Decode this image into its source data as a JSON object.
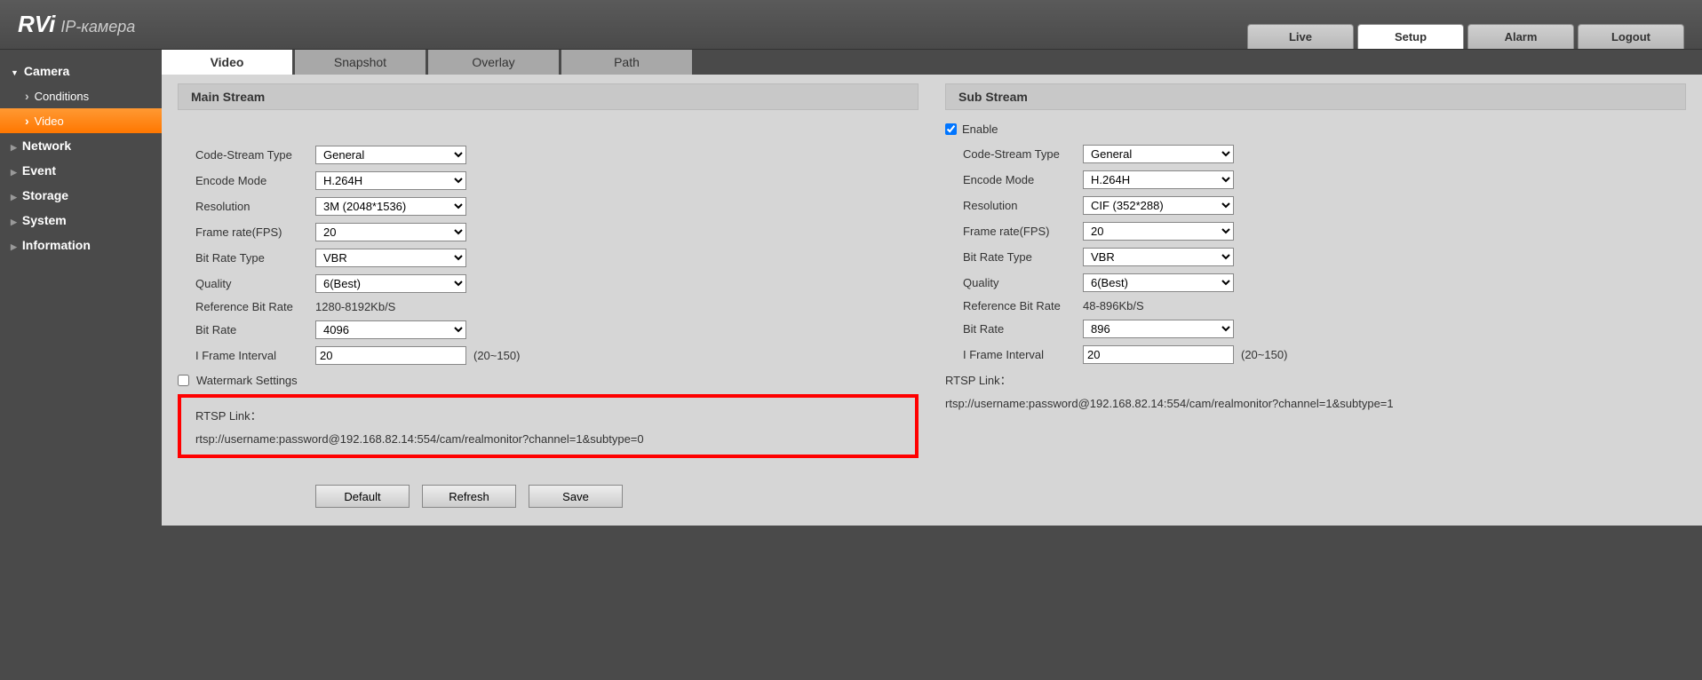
{
  "logo": {
    "brand": "RVi",
    "text": "IP-камера"
  },
  "top_tabs": {
    "live": "Live",
    "setup": "Setup",
    "alarm": "Alarm",
    "logout": "Logout"
  },
  "sidebar": {
    "camera": {
      "label": "Camera",
      "conditions": "Conditions",
      "video": "Video"
    },
    "network": "Network",
    "event": "Event",
    "storage": "Storage",
    "system": "System",
    "information": "Information"
  },
  "sub_tabs": {
    "video": "Video",
    "snapshot": "Snapshot",
    "overlay": "Overlay",
    "path": "Path"
  },
  "main_stream": {
    "title": "Main Stream",
    "code_stream_type_label": "Code-Stream Type",
    "code_stream_type": "General",
    "encode_mode_label": "Encode Mode",
    "encode_mode": "H.264H",
    "resolution_label": "Resolution",
    "resolution": "3M (2048*1536)",
    "fps_label": "Frame rate(FPS)",
    "fps": "20",
    "bit_rate_type_label": "Bit Rate Type",
    "bit_rate_type": "VBR",
    "quality_label": "Quality",
    "quality": "6(Best)",
    "ref_bit_rate_label": "Reference Bit Rate",
    "ref_bit_rate": "1280-8192Kb/S",
    "bit_rate_label": "Bit Rate",
    "bit_rate": "4096",
    "iframe_label": "I Frame Interval",
    "iframe": "20",
    "iframe_hint": "(20~150)",
    "watermark_label": "Watermark Settings",
    "rtsp_title": "RTSP Link：",
    "rtsp": "rtsp://username:password@192.168.82.14:554/cam/realmonitor?channel=1&subtype=0"
  },
  "sub_stream": {
    "title": "Sub Stream",
    "enable_label": "Enable",
    "code_stream_type_label": "Code-Stream Type",
    "code_stream_type": "General",
    "encode_mode_label": "Encode Mode",
    "encode_mode": "H.264H",
    "resolution_label": "Resolution",
    "resolution": "CIF (352*288)",
    "fps_label": "Frame rate(FPS)",
    "fps": "20",
    "bit_rate_type_label": "Bit Rate Type",
    "bit_rate_type": "VBR",
    "quality_label": "Quality",
    "quality": "6(Best)",
    "ref_bit_rate_label": "Reference Bit Rate",
    "ref_bit_rate": "48-896Kb/S",
    "bit_rate_label": "Bit Rate",
    "bit_rate": "896",
    "iframe_label": "I Frame Interval",
    "iframe": "20",
    "iframe_hint": "(20~150)",
    "rtsp_title": "RTSP Link：",
    "rtsp": "rtsp://username:password@192.168.82.14:554/cam/realmonitor?channel=1&subtype=1"
  },
  "buttons": {
    "default": "Default",
    "refresh": "Refresh",
    "save": "Save"
  }
}
